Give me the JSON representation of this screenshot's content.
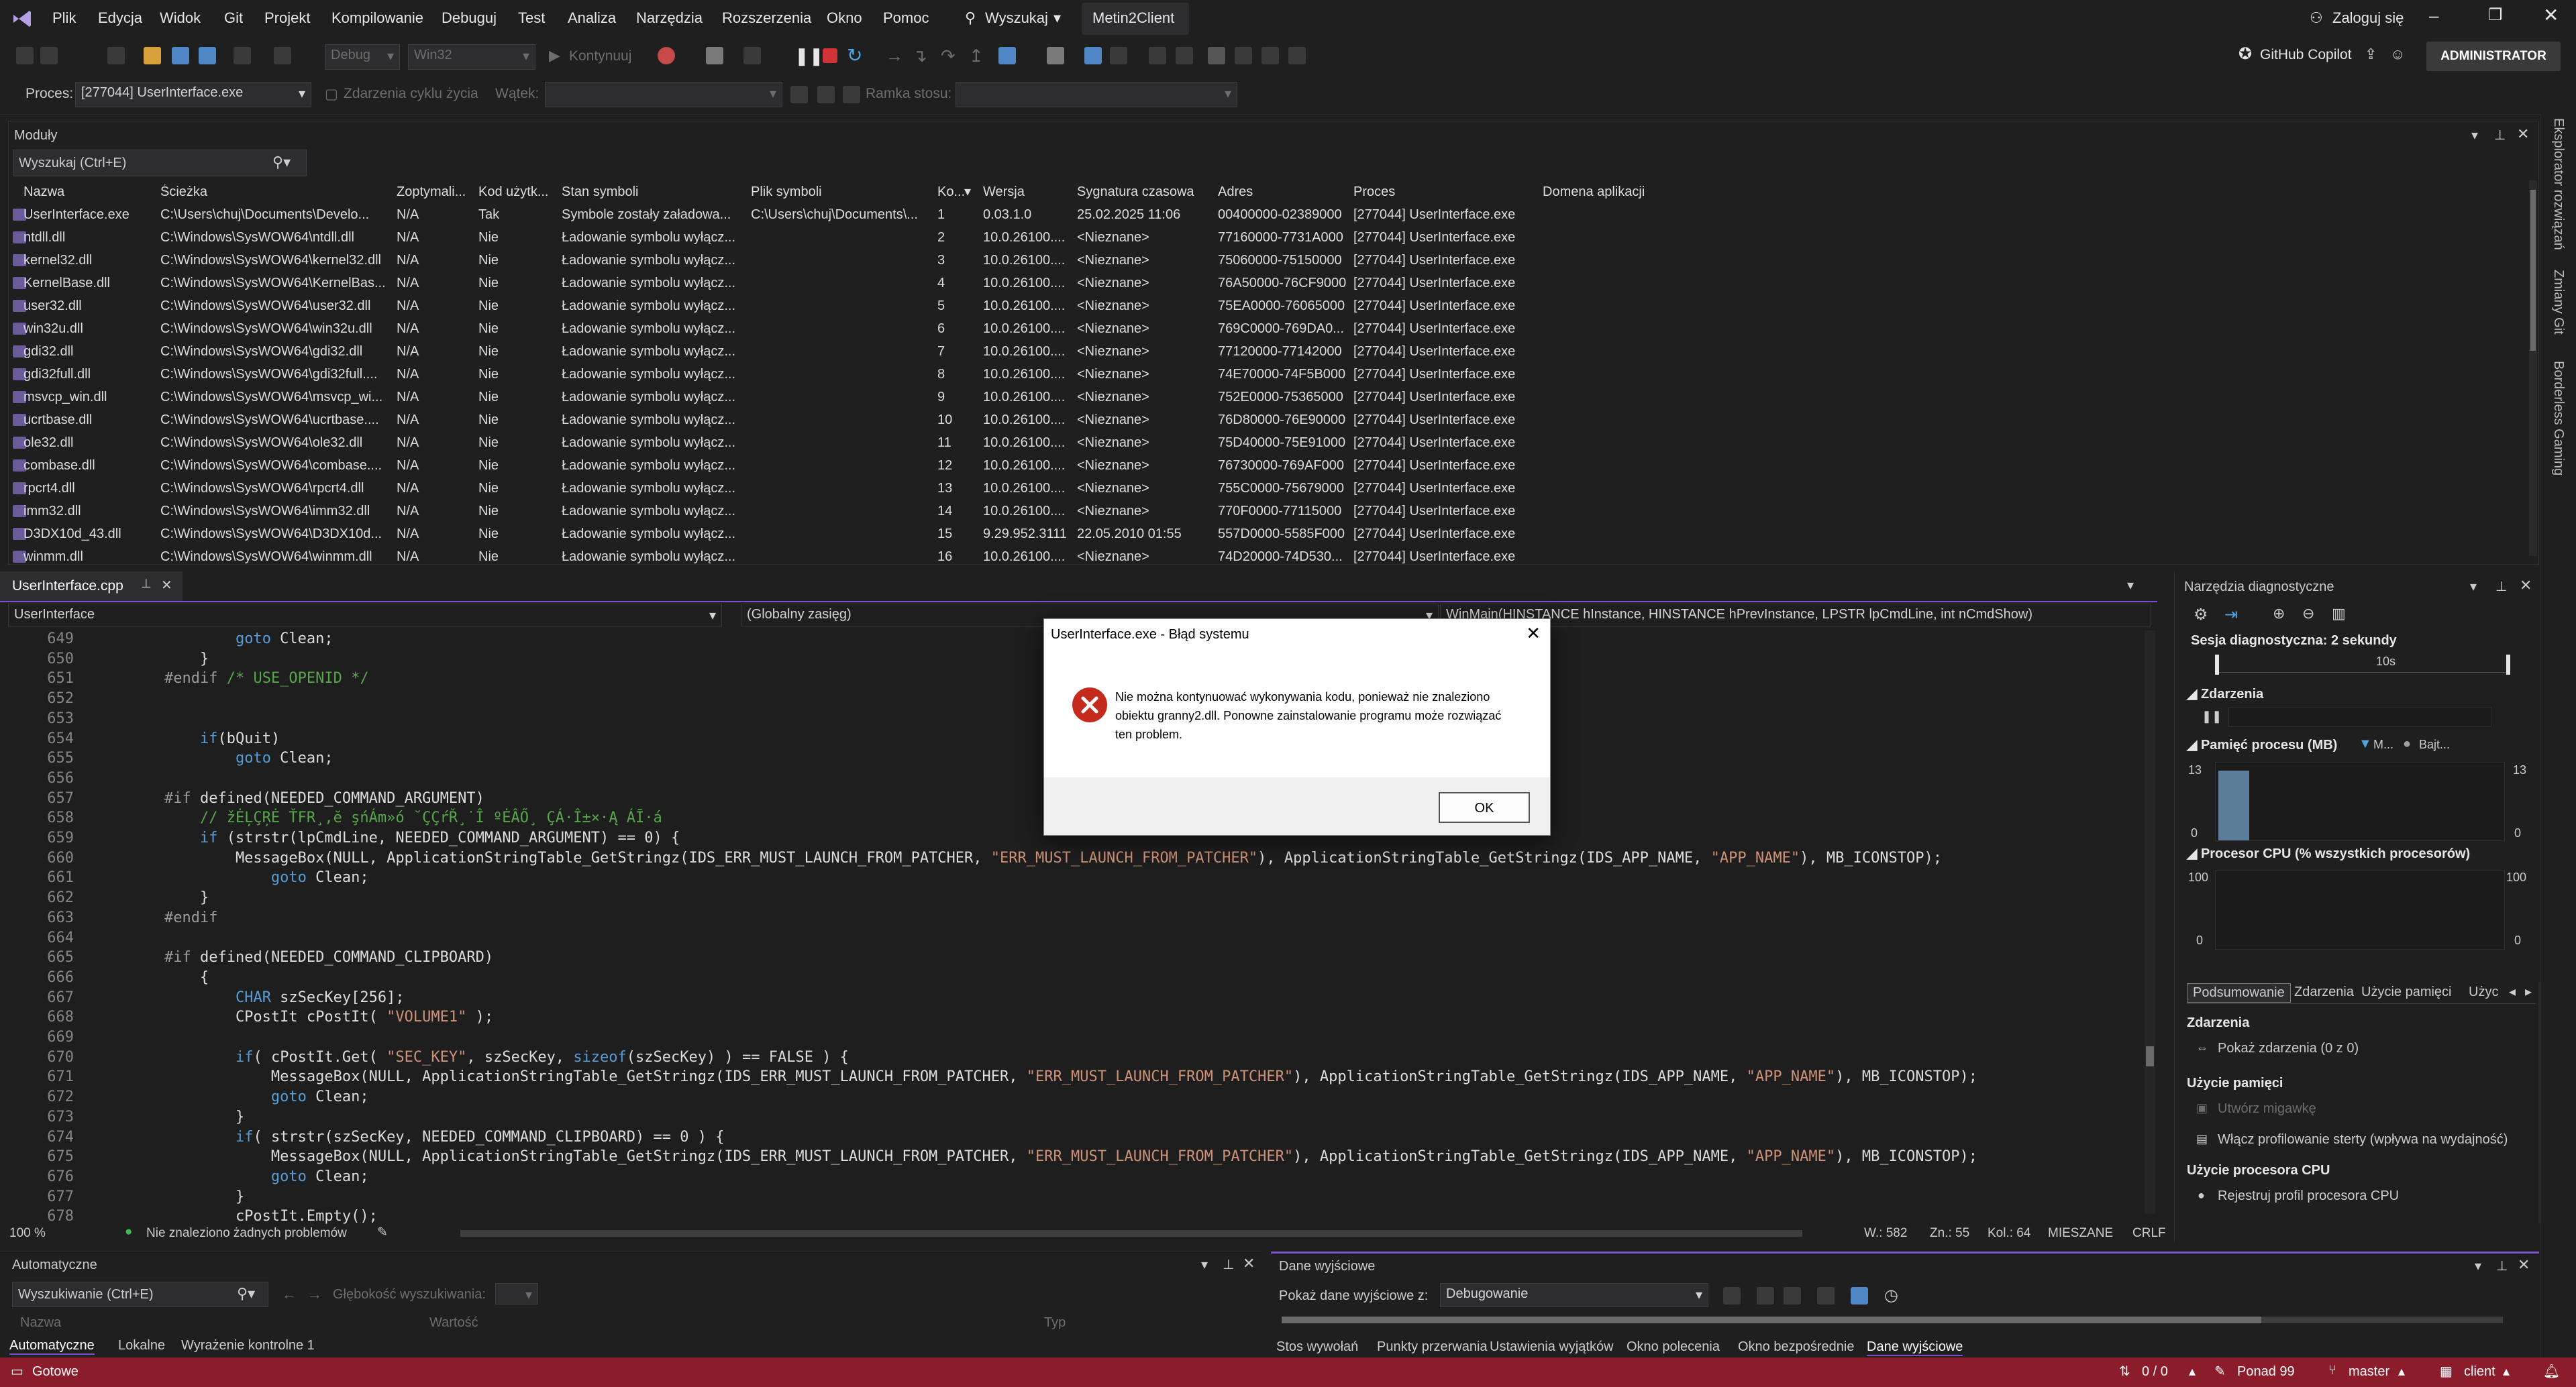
{
  "menu": {
    "items": [
      "Plik",
      "Edycja",
      "Widok",
      "Git",
      "Projekt",
      "Kompilowanie",
      "Debuguj",
      "Test",
      "Analiza",
      "Narzędzia",
      "Rozszerzenia",
      "Okno",
      "Pomoc"
    ],
    "search": "Wyszukaj",
    "solution": "Metin2Client",
    "signin": "Zaloguj się",
    "admin": "ADMINISTRATOR",
    "copilot": "GitHub Copilot"
  },
  "toolbar": {
    "config": "Debug",
    "platform": "Win32",
    "continue": "Kontynuuj"
  },
  "toolbar2": {
    "process_label": "Proces:",
    "process_value": "[277044] UserInterface.exe",
    "lifecycle": "Zdarzenia cyklu życia",
    "thread_label": "Wątek:",
    "stack_label": "Ramka stosu:"
  },
  "modules": {
    "title": "Moduły",
    "search_placeholder": "Wyszukaj (Ctrl+E)",
    "columns": [
      "Nazwa",
      "Ścieżka",
      "Zoptymali...",
      "Kod użytk...",
      "Stan symboli",
      "Plik symboli",
      "Ko...",
      "Wersja",
      "Sygnatura czasowa",
      "Adres",
      "Proces",
      "Domena aplikacji"
    ],
    "rows": [
      [
        "UserInterface.exe",
        "C:\\Users\\chuj\\Documents\\Develo...",
        "N/A",
        "Tak",
        "Symbole zostały załadowa...",
        "C:\\Users\\chuj\\Documents\\...",
        "1",
        "0.03.1.0",
        "25.02.2025 11:06",
        "00400000-02389000",
        "[277044] UserInterface.exe",
        ""
      ],
      [
        "ntdll.dll",
        "C:\\Windows\\SysWOW64\\ntdll.dll",
        "N/A",
        "Nie",
        "Ładowanie symbolu wyłącz...",
        "",
        "2",
        "10.0.26100....",
        "<Nieznane>",
        "77160000-7731A000",
        "[277044] UserInterface.exe",
        ""
      ],
      [
        "kernel32.dll",
        "C:\\Windows\\SysWOW64\\kernel32.dll",
        "N/A",
        "Nie",
        "Ładowanie symbolu wyłącz...",
        "",
        "3",
        "10.0.26100....",
        "<Nieznane>",
        "75060000-75150000",
        "[277044] UserInterface.exe",
        ""
      ],
      [
        "KernelBase.dll",
        "C:\\Windows\\SysWOW64\\KernelBas...",
        "N/A",
        "Nie",
        "Ładowanie symbolu wyłącz...",
        "",
        "4",
        "10.0.26100....",
        "<Nieznane>",
        "76A50000-76CF9000",
        "[277044] UserInterface.exe",
        ""
      ],
      [
        "user32.dll",
        "C:\\Windows\\SysWOW64\\user32.dll",
        "N/A",
        "Nie",
        "Ładowanie symbolu wyłącz...",
        "",
        "5",
        "10.0.26100....",
        "<Nieznane>",
        "75EA0000-76065000",
        "[277044] UserInterface.exe",
        ""
      ],
      [
        "win32u.dll",
        "C:\\Windows\\SysWOW64\\win32u.dll",
        "N/A",
        "Nie",
        "Ładowanie symbolu wyłącz...",
        "",
        "6",
        "10.0.26100....",
        "<Nieznane>",
        "769C0000-769DA0...",
        "[277044] UserInterface.exe",
        ""
      ],
      [
        "gdi32.dll",
        "C:\\Windows\\SysWOW64\\gdi32.dll",
        "N/A",
        "Nie",
        "Ładowanie symbolu wyłącz...",
        "",
        "7",
        "10.0.26100....",
        "<Nieznane>",
        "77120000-77142000",
        "[277044] UserInterface.exe",
        ""
      ],
      [
        "gdi32full.dll",
        "C:\\Windows\\SysWOW64\\gdi32full....",
        "N/A",
        "Nie",
        "Ładowanie symbolu wyłącz...",
        "",
        "8",
        "10.0.26100....",
        "<Nieznane>",
        "74E70000-74F5B000",
        "[277044] UserInterface.exe",
        ""
      ],
      [
        "msvcp_win.dll",
        "C:\\Windows\\SysWOW64\\msvcp_wi...",
        "N/A",
        "Nie",
        "Ładowanie symbolu wyłącz...",
        "",
        "9",
        "10.0.26100....",
        "<Nieznane>",
        "752E0000-75365000",
        "[277044] UserInterface.exe",
        ""
      ],
      [
        "ucrtbase.dll",
        "C:\\Windows\\SysWOW64\\ucrtbase....",
        "N/A",
        "Nie",
        "Ładowanie symbolu wyłącz...",
        "",
        "10",
        "10.0.26100....",
        "<Nieznane>",
        "76D80000-76E90000",
        "[277044] UserInterface.exe",
        ""
      ],
      [
        "ole32.dll",
        "C:\\Windows\\SysWOW64\\ole32.dll",
        "N/A",
        "Nie",
        "Ładowanie symbolu wyłącz...",
        "",
        "11",
        "10.0.26100....",
        "<Nieznane>",
        "75D40000-75E91000",
        "[277044] UserInterface.exe",
        ""
      ],
      [
        "combase.dll",
        "C:\\Windows\\SysWOW64\\combase....",
        "N/A",
        "Nie",
        "Ładowanie symbolu wyłącz...",
        "",
        "12",
        "10.0.26100....",
        "<Nieznane>",
        "76730000-769AF000",
        "[277044] UserInterface.exe",
        ""
      ],
      [
        "rpcrt4.dll",
        "C:\\Windows\\SysWOW64\\rpcrt4.dll",
        "N/A",
        "Nie",
        "Ładowanie symbolu wyłącz...",
        "",
        "13",
        "10.0.26100....",
        "<Nieznane>",
        "755C0000-75679000",
        "[277044] UserInterface.exe",
        ""
      ],
      [
        "imm32.dll",
        "C:\\Windows\\SysWOW64\\imm32.dll",
        "N/A",
        "Nie",
        "Ładowanie symbolu wyłącz...",
        "",
        "14",
        "10.0.26100....",
        "<Nieznane>",
        "770F0000-77115000",
        "[277044] UserInterface.exe",
        ""
      ],
      [
        "D3DX10d_43.dll",
        "C:\\Windows\\SysWOW64\\D3DX10d...",
        "N/A",
        "Nie",
        "Ładowanie symbolu wyłącz...",
        "",
        "15",
        "9.29.952.3111",
        "22.05.2010 01:55",
        "557D0000-5585F000",
        "[277044] UserInterface.exe",
        ""
      ],
      [
        "winmm.dll",
        "C:\\Windows\\SysWOW64\\winmm.dll",
        "N/A",
        "Nie",
        "Ładowanie symbolu wyłącz...",
        "",
        "16",
        "10.0.26100....",
        "<Nieznane>",
        "74D20000-74D530...",
        "[277044] UserInterface.exe",
        ""
      ]
    ]
  },
  "editor": {
    "tab": "UserInterface.cpp",
    "project": "UserInterface",
    "scope": "(Globalny zasięg)",
    "function": "WinMain(HINSTANCE hInstance, HINSTANCE hPrevInstance, LPSTR lpCmdLine, int nCmdShow)",
    "zoom": "100 %",
    "problems": "Nie znaleziono żadnych problemów",
    "pos_line": "W.: 582",
    "pos_char": "Zn.: 55",
    "pos_col": "Kol.: 64",
    "indent": "MIESZANE",
    "eol": "CRLF",
    "lines": [
      {
        "n": "649",
        "t": "            goto Clean;"
      },
      {
        "n": "650",
        "t": "        }"
      },
      {
        "n": "651",
        "t": "    #endif /* USE_OPENID */"
      },
      {
        "n": "652",
        "t": ""
      },
      {
        "n": "653",
        "t": ""
      },
      {
        "n": "654",
        "t": "        if(bQuit)"
      },
      {
        "n": "655",
        "t": "            goto Clean;"
      },
      {
        "n": "656",
        "t": ""
      },
      {
        "n": "657",
        "t": "    #if defined(NEEDED_COMMAND_ARGUMENT)"
      },
      {
        "n": "658",
        "t": "        // žĖĻÇŖĖ ŤFR¸,ĕ şńÁm»ó ˘ÇÇŕŘ¸˙Î ºĖÂŐ¸ ÇÁ·Î±×·Ą ÁĪ·á"
      },
      {
        "n": "659",
        "t": "        if (strstr(lpCmdLine, NEEDED_COMMAND_ARGUMENT) == 0) {"
      },
      {
        "n": "660",
        "t": "            MessageBox(NULL, ApplicationStringTable_GetStringz(IDS_ERR_MUST_LAUNCH_FROM_PATCHER, \"ERR_MUST_LAUNCH_FROM_PATCHER\"), ApplicationStringTable_GetStringz(IDS_APP_NAME, \"APP_NAME\"), MB_ICONSTOP);"
      },
      {
        "n": "661",
        "t": "                goto Clean;"
      },
      {
        "n": "662",
        "t": "        }"
      },
      {
        "n": "663",
        "t": "    #endif"
      },
      {
        "n": "664",
        "t": ""
      },
      {
        "n": "665",
        "t": "    #if defined(NEEDED_COMMAND_CLIPBOARD)"
      },
      {
        "n": "666",
        "t": "        {"
      },
      {
        "n": "667",
        "t": "            CHAR szSecKey[256];"
      },
      {
        "n": "668",
        "t": "            CPostIt cPostIt( \"VOLUME1\" );"
      },
      {
        "n": "669",
        "t": ""
      },
      {
        "n": "670",
        "t": "            if( cPostIt.Get( \"SEC_KEY\", szSecKey, sizeof(szSecKey) ) == FALSE ) {"
      },
      {
        "n": "671",
        "t": "                MessageBox(NULL, ApplicationStringTable_GetStringz(IDS_ERR_MUST_LAUNCH_FROM_PATCHER, \"ERR_MUST_LAUNCH_FROM_PATCHER\"), ApplicationStringTable_GetStringz(IDS_APP_NAME, \"APP_NAME\"), MB_ICONSTOP);"
      },
      {
        "n": "672",
        "t": "                goto Clean;"
      },
      {
        "n": "673",
        "t": "            }"
      },
      {
        "n": "674",
        "t": "            if( strstr(szSecKey, NEEDED_COMMAND_CLIPBOARD) == 0 ) {"
      },
      {
        "n": "675",
        "t": "                MessageBox(NULL, ApplicationStringTable_GetStringz(IDS_ERR_MUST_LAUNCH_FROM_PATCHER, \"ERR_MUST_LAUNCH_FROM_PATCHER\"), ApplicationStringTable_GetStringz(IDS_APP_NAME, \"APP_NAME\"), MB_ICONSTOP);"
      },
      {
        "n": "676",
        "t": "                goto Clean;"
      },
      {
        "n": "677",
        "t": "            }"
      },
      {
        "n": "678",
        "t": "            cPostIt.Empty();"
      }
    ]
  },
  "diag": {
    "title": "Narzędzia diagnostyczne",
    "session": "Sesja diagnostyczna: 2 sekundy",
    "timeline_tick": "10s",
    "events": "Zdarzenia",
    "memory": "Pamięć procesu (MB)",
    "mem_legend1": "M...",
    "mem_legend2": "Bajt...",
    "mem_max": "13",
    "mem_min": "0",
    "cpu": "Procesor CPU (% wszystkich procesorów)",
    "cpu_max": "100",
    "cpu_min": "0",
    "tabs": [
      "Podsumowanie",
      "Zdarzenia",
      "Użycie pamięci",
      "Użyc"
    ],
    "sec_events": "Zdarzenia",
    "show_events": "Pokaż zdarzenia (0 z 0)",
    "sec_memory": "Użycie pamięci",
    "snapshot": "Utwórz migawkę",
    "heap_profiling": "Włącz profilowanie sterty (wpływa na wydajność)",
    "sec_cpu": "Użycie procesora CPU",
    "cpu_profile": "Rejestruj profil procesora CPU"
  },
  "auto": {
    "title": "Automatyczne",
    "search_placeholder": "Wyszukiwanie (Ctrl+E)",
    "depth": "Głębokość wyszukiwania:",
    "col_name": "Nazwa",
    "col_value": "Wartość",
    "col_type": "Typ",
    "tabs": [
      "Automatyczne",
      "Lokalne",
      "Wyrażenie kontrolne 1"
    ]
  },
  "output": {
    "title": "Dane wyjściowe",
    "show_label": "Pokaż dane wyjściowe z:",
    "source": "Debugowanie",
    "tabs": [
      "Stos wywołań",
      "Punkty przerwania",
      "Ustawienia wyjątków",
      "Okno polecenia",
      "Okno bezpośrednie",
      "Dane wyjściowe"
    ]
  },
  "status": {
    "ready": "Gotowe",
    "lines": "0 / 0",
    "pending": "Ponad 99",
    "branch": "master",
    "repo": "client"
  },
  "rail": {
    "items": [
      "Eksplorator rozwiązań",
      "Zmiany Git",
      "Borderless Gaming"
    ]
  },
  "dialog": {
    "title": "UserInterface.exe - Błąd systemu",
    "message": "Nie można kontynuować wykonywania kodu, ponieważ nie znaleziono obiektu granny2.dll. Ponowne zainstalowanie programu może rozwiązać ten problem.",
    "ok": "OK"
  },
  "colors": {
    "status_bar": "#8b1c2b",
    "accent": "#7a50c4",
    "error_icon": "#c42b1c"
  }
}
